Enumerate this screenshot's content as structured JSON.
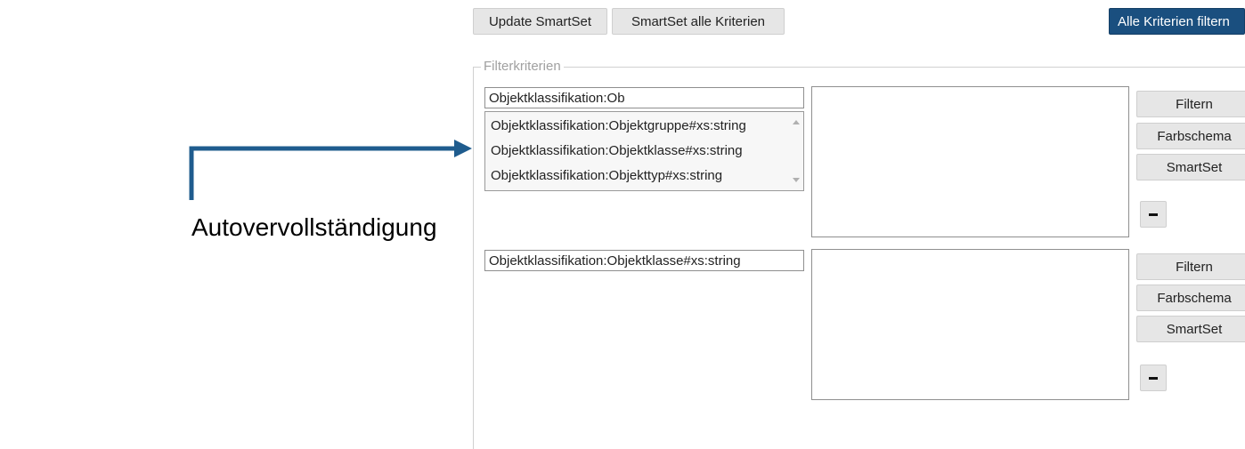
{
  "toolbar": {
    "update_smartset_label": "Update SmartSet",
    "smartset_all_criteria_label": "SmartSet alle Kriterien",
    "filter_all_criteria_label": "Alle Kriterien filtern"
  },
  "filter_section": {
    "legend": "Filterkriterien",
    "rows": [
      {
        "input_value": "Objektklassifikation:Ob",
        "autocomplete": [
          "Objektklassifikation:Objektgruppe#xs:string",
          "Objektklassifikation:Objektklasse#xs:string",
          "Objektklassifikation:Objekttyp#xs:string"
        ],
        "filter_label": "Filtern",
        "color_scheme_label": "Farbschema",
        "smartset_label": "SmartSet"
      },
      {
        "input_value": "Objektklassifikation:Objektklasse#xs:string",
        "filter_label": "Filtern",
        "color_scheme_label": "Farbschema",
        "smartset_label": "SmartSet"
      }
    ]
  },
  "callout": {
    "label": "Autovervollständigung",
    "arrow_color": "#1f5c8e"
  },
  "colors": {
    "primary_button": "#1a4f7f",
    "button_bg": "#e6e6e6"
  }
}
